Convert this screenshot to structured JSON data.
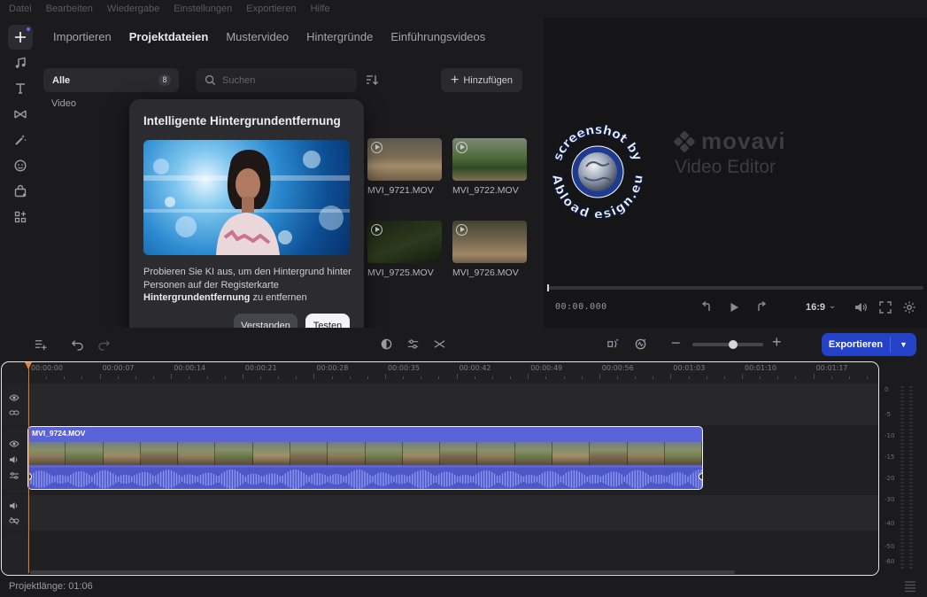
{
  "menu": [
    "Datei",
    "Bearbeiten",
    "Wiedergabe",
    "Einstellungen",
    "Exportieren",
    "Hilfe"
  ],
  "rail": [
    {
      "icon": "plus-icon",
      "active": true
    },
    {
      "icon": "music-note-icon"
    },
    {
      "icon": "text-icon"
    },
    {
      "icon": "transition-icon"
    },
    {
      "icon": "magic-wand-icon"
    },
    {
      "icon": "sticker-smiley-icon"
    },
    {
      "icon": "store-bag-icon"
    },
    {
      "icon": "more-tools-icon"
    }
  ],
  "tabs": [
    "Importieren",
    "Projektdateien",
    "Mustervideo",
    "Hintergründe",
    "Einführungsvideos"
  ],
  "active_tab": "Projektdateien",
  "folders": {
    "all_label": "Alle",
    "all_count": "8",
    "video_label": "Video"
  },
  "search": {
    "placeholder": "Suchen"
  },
  "add_button": "Hinzufügen",
  "media": [
    {
      "name": "MVI_9721.MOV"
    },
    {
      "name": "MVI_9722.MOV"
    },
    {
      "name": "MVI_9725.MOV"
    },
    {
      "name": "MVI_9726.MOV"
    }
  ],
  "popup": {
    "title": "Intelligente Hintergrundentfernung",
    "text_part1": "Probieren Sie KI aus, um den Hintergrund hinter Personen auf der Registerkarte ",
    "text_bold": "Hintergrundentfernung",
    "text_part2": " zu entfernen",
    "ok_label": "Verstanden",
    "try_label": "Testen"
  },
  "player": {
    "brand_name": "movavi",
    "brand_product": "Video Editor",
    "watermark_top": "screenshot by",
    "watermark_bottom": "Abload esign.eu",
    "time": "00:00.000",
    "ratio": "16:9"
  },
  "timeline_toolbar": {
    "export_label": "Exportieren",
    "zoom_level": 0.57
  },
  "ruler": [
    "00:00:00",
    "00:00:07",
    "00:00:14",
    "00:00:21",
    "00:00:28",
    "00:00:35",
    "00:00:42",
    "00:00:49",
    "00:00:56",
    "00:01:03",
    "00:01:10",
    "00:01:17"
  ],
  "clip": {
    "name": "MVI_9724.MOV"
  },
  "meter_labels": [
    "0",
    "-5",
    "-10",
    "-15",
    "-20",
    "-30",
    "-40",
    "-50",
    "-60"
  ],
  "status": {
    "project_length": "Projektlänge: 01:06"
  },
  "colors": {
    "accent": "#2442c7",
    "clip": "#5b63d8",
    "playhead": "#d9792a",
    "bg": "#1b1b1e"
  }
}
